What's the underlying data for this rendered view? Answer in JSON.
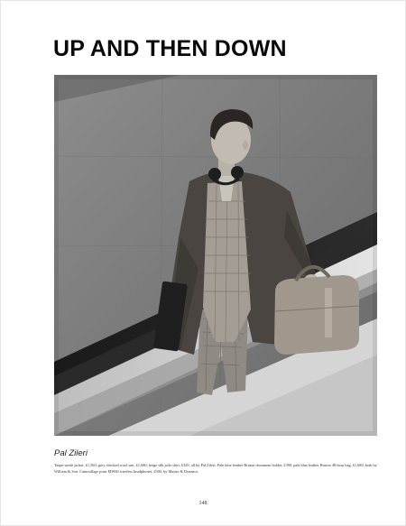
{
  "page": {
    "headline": "UP AND THEN DOWN",
    "designer": "Pal Zileri",
    "credits": "Taupe suede jacket, £1,560; grey checked wool suit, £1,680; beige silk polo shirt, £329, all by Pal Zileri. Pale blue leather Bruton document holder, £390; pale blue leather Bruton 48-hour bag, £1,680, both by William & Son. Camouflage print MW60 wireless headphones, £500, by Master & Dynamic",
    "page_number": "148"
  }
}
